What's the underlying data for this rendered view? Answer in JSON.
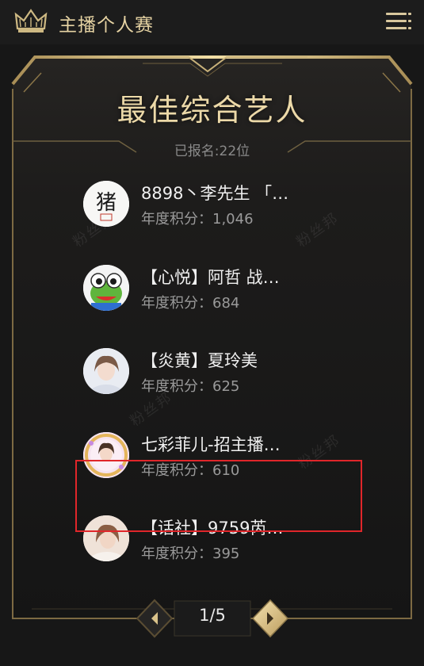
{
  "header": {
    "title": "主播个人赛"
  },
  "panel": {
    "title": "最佳综合艺人",
    "registered": "已报名:22位"
  },
  "entries": [
    {
      "name": "8898丶李先生 「…",
      "score": "年度积分：1,046"
    },
    {
      "name": "【心悦】阿哲 战…",
      "score": "年度积分：684"
    },
    {
      "name": "【炎黄】夏玲美",
      "score": "年度积分：625"
    },
    {
      "name": "七彩菲儿-招主播…",
      "score": "年度积分：610"
    },
    {
      "name": "【话社】9759芮…",
      "score": "年度积分：395"
    }
  ],
  "pagination": {
    "label": "1/5"
  },
  "watermark": "粉丝邦",
  "colors": {
    "gold": "#d9c28a",
    "background": "#171717",
    "highlight": "#e0262a"
  }
}
